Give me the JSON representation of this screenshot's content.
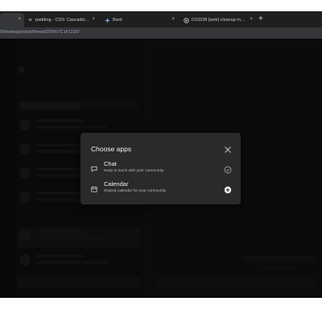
{
  "browser": {
    "tabs": [
      {
        "label": "",
        "favicon": "page-icon",
        "active": true
      },
      {
        "label": "padding - CSS: Cascading St...",
        "favicon": "w",
        "active": false
      },
      {
        "label": "Bard",
        "favicon": "bard-icon",
        "active": false
      },
      {
        "label": "D10238 [web] cleanup m...",
        "favicon": "record-icon",
        "active": false
      }
    ],
    "new_tab_label": "+",
    "close_glyph": "×",
    "url": "00/webapp/chat/thread/256%7C141220/"
  },
  "modal": {
    "title": "Choose apps",
    "apps": [
      {
        "name": "Chat",
        "description": "Keep in touch with your community",
        "icon": "chat-bubble-icon",
        "status": "added"
      },
      {
        "name": "Calendar",
        "description": "Shared calendar for your community",
        "icon": "calendar-icon",
        "status": "add"
      }
    ]
  },
  "colors": {
    "modal_bg": "#2a2a2c",
    "overlay": "rgba(0,0,0,0.58)",
    "text": "#f1f1f1"
  }
}
